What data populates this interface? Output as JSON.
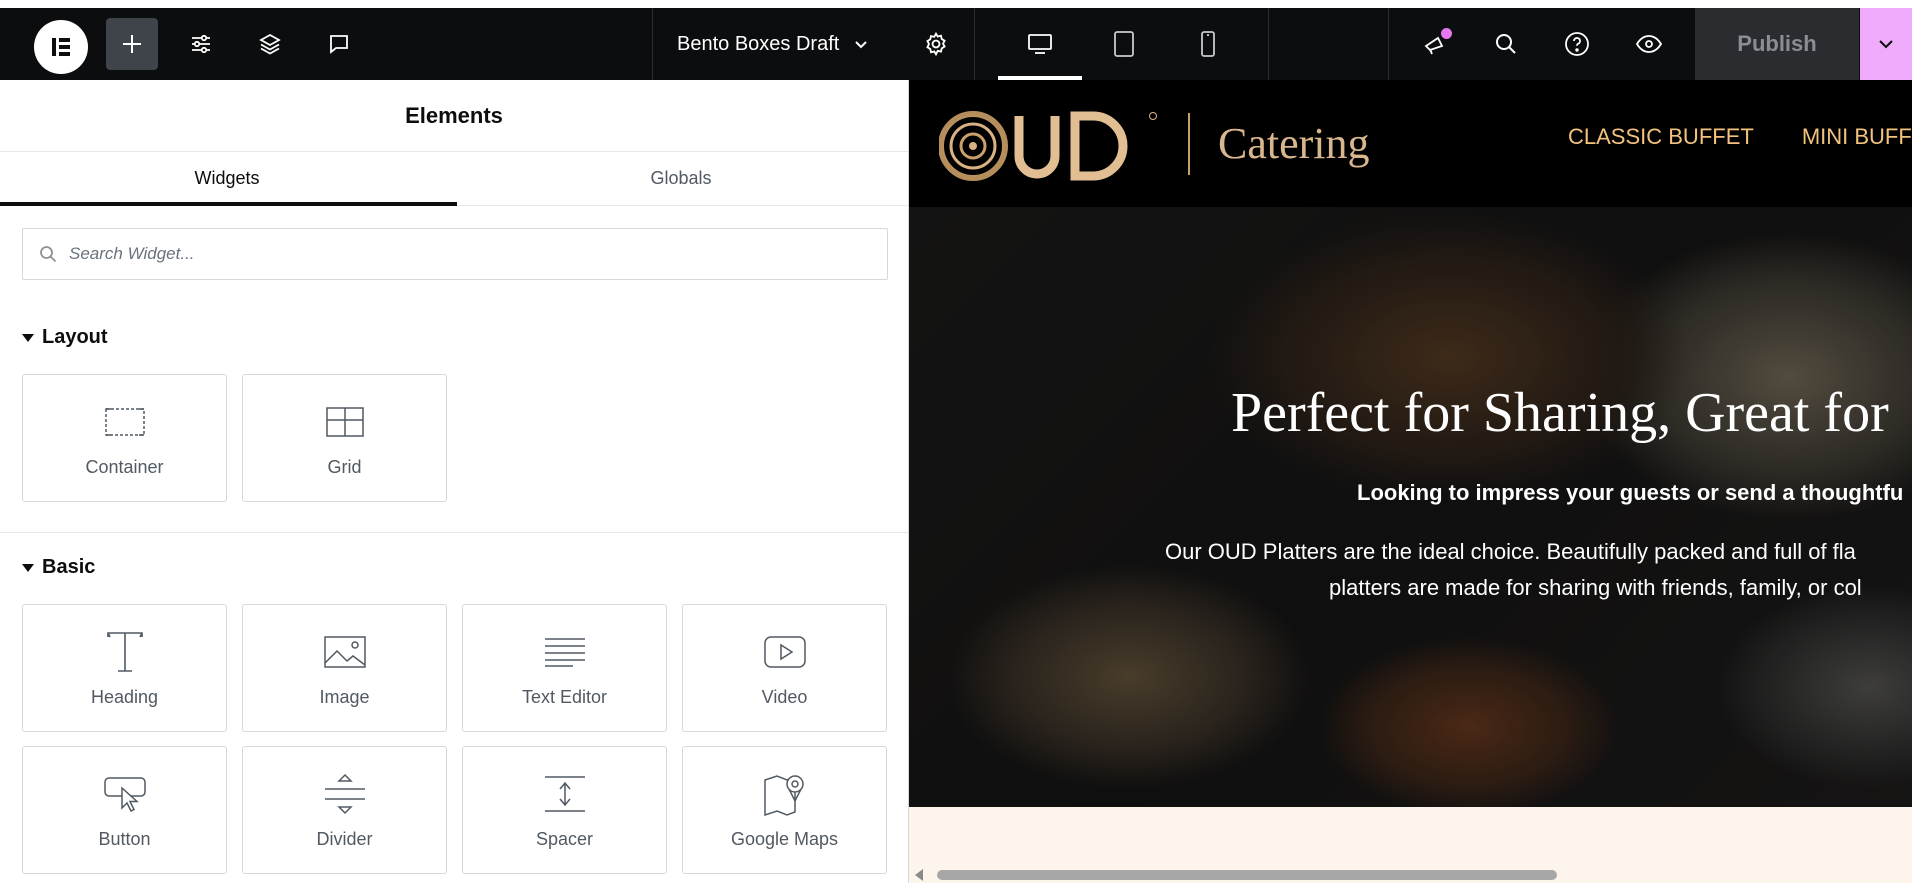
{
  "topbar": {
    "document_title": "Bento Boxes Draft",
    "publish_label": "Publish",
    "icons": {
      "logo": "elementor-logo-icon",
      "add": "plus-icon",
      "settings": "sliders-icon",
      "structure": "layers-icon",
      "comments": "chat-bubble-icon",
      "page_settings": "gear-icon",
      "desktop": "desktop-icon",
      "tablet": "tablet-icon",
      "mobile": "mobile-icon",
      "whats_new": "megaphone-icon",
      "finder": "search-icon",
      "help": "help-icon",
      "preview": "eye-icon",
      "publish_options": "chevron-down-icon"
    },
    "colors": {
      "bar": "#0c0d0e",
      "publish_accent": "#f0abfc",
      "notification": "#e579f0"
    }
  },
  "panel": {
    "title": "Elements",
    "tabs": [
      {
        "label": "Widgets",
        "active": true
      },
      {
        "label": "Globals",
        "active": false
      }
    ],
    "search": {
      "placeholder": "Search Widget...",
      "value": ""
    },
    "sections": [
      {
        "title": "Layout",
        "widgets": [
          {
            "label": "Container",
            "icon": "container-icon"
          },
          {
            "label": "Grid",
            "icon": "grid-icon"
          }
        ]
      },
      {
        "title": "Basic",
        "widgets": [
          {
            "label": "Heading",
            "icon": "heading-icon"
          },
          {
            "label": "Image",
            "icon": "image-icon"
          },
          {
            "label": "Text Editor",
            "icon": "text-editor-icon"
          },
          {
            "label": "Video",
            "icon": "video-icon"
          },
          {
            "label": "Button",
            "icon": "button-icon"
          },
          {
            "label": "Divider",
            "icon": "divider-icon"
          },
          {
            "label": "Spacer",
            "icon": "spacer-icon"
          },
          {
            "label": "Google Maps",
            "icon": "map-icon"
          }
        ]
      }
    ]
  },
  "preview": {
    "brand": {
      "logo_text": "OUD",
      "tagline": "Catering"
    },
    "nav": [
      "CLASSIC BUFFET",
      "MINI BUFFET"
    ],
    "hero": {
      "title": "Perfect for Sharing, Great for",
      "subtitle": "Looking to impress your guests or send a thoughtfu",
      "paragraph_line1": "Our OUD Platters are the ideal choice. Beautifully packed and full of fla",
      "paragraph_line2": "platters are made for sharing with friends, family, or col"
    },
    "colors": {
      "header_bg": "#000000",
      "nav_text": "#f3c27f",
      "brand_gold": "#d9b78e",
      "page_bg": "#fdf5ec"
    }
  }
}
